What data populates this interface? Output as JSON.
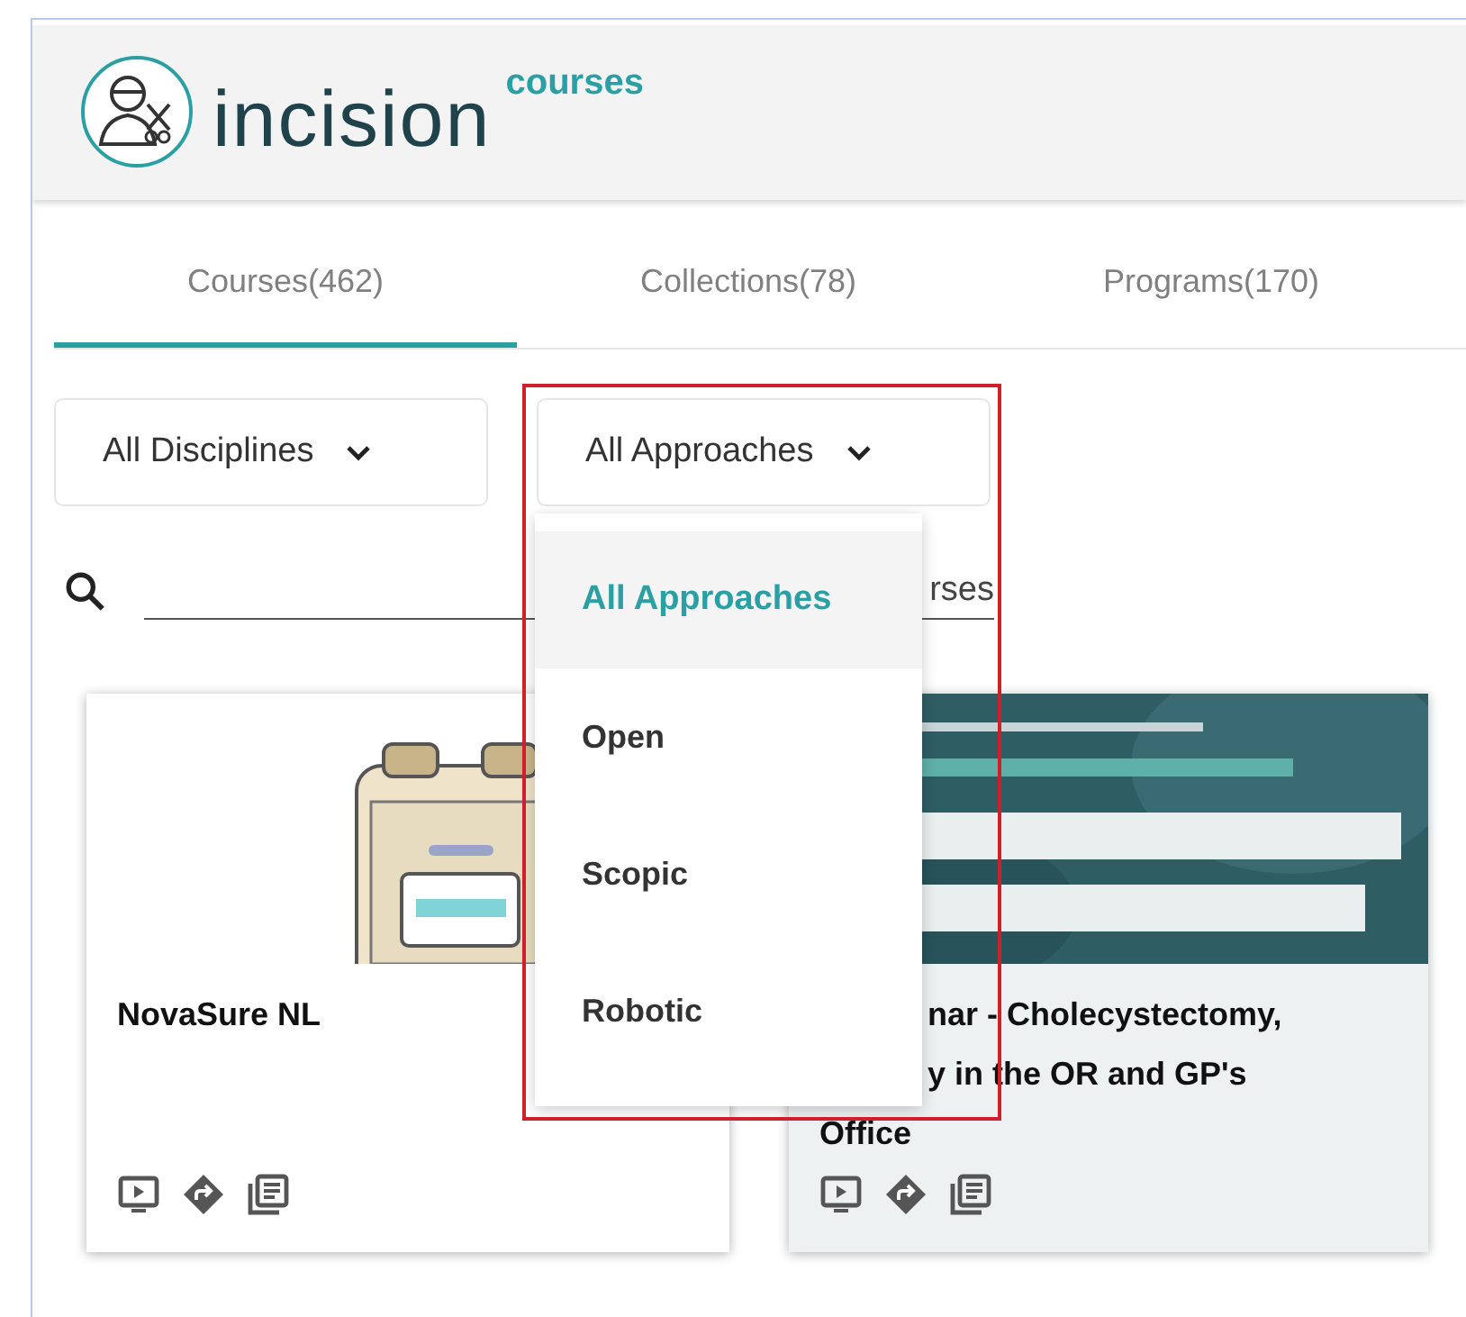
{
  "header": {
    "logo_text": "incision",
    "logo_sub": "courses"
  },
  "tabs": [
    {
      "label": "Courses(462)",
      "selected": true
    },
    {
      "label": "Collections(78)",
      "selected": false
    },
    {
      "label": "Programs(170)",
      "selected": false
    }
  ],
  "filters": [
    {
      "label": "All Disciplines"
    },
    {
      "label": "All Approaches"
    }
  ],
  "dropdown": {
    "items": [
      {
        "label": "All Approaches",
        "selected": true
      },
      {
        "label": "Open",
        "selected": false
      },
      {
        "label": "Scopic",
        "selected": false
      },
      {
        "label": "Robotic",
        "selected": false
      }
    ]
  },
  "search": {
    "placeholder": "rses"
  },
  "cards": [
    {
      "kind": "device",
      "title_lines": [
        "NovaSure NL"
      ]
    },
    {
      "kind": "poster",
      "title_lines": [
        "nar - Cholecystectomy,",
        "y in the OR and GP's",
        "Office"
      ]
    }
  ]
}
